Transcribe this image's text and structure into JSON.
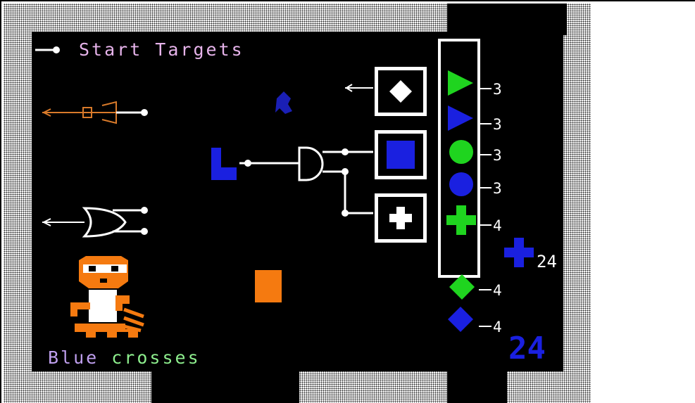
{
  "header": {
    "title": "Start Targets"
  },
  "status": {
    "message": "Blue crosses"
  },
  "targets": [
    {
      "shape": "triangle",
      "color": "#1fd41f",
      "count": "3"
    },
    {
      "shape": "triangle",
      "color": "#1a20e0",
      "count": "3"
    },
    {
      "shape": "circle",
      "color": "#1fd41f",
      "count": "3"
    },
    {
      "shape": "circle",
      "color": "#1a20e0",
      "count": "3"
    },
    {
      "shape": "cross",
      "color": "#1fd41f",
      "count": "4"
    }
  ],
  "extra_targets": [
    {
      "shape": "diamond",
      "color": "#1fd41f",
      "count": "4"
    },
    {
      "shape": "diamond",
      "color": "#1a20e0",
      "count": "4"
    }
  ],
  "score": {
    "item_count": "24",
    "corner_number": "24"
  },
  "gate_boxes": [
    {
      "symbol": "diamond",
      "color": "#ffffff"
    },
    {
      "symbol": "square",
      "color": "#1a20e0"
    },
    {
      "symbol": "cross",
      "color": "#ffffff"
    }
  ],
  "colors": {
    "green": "#1fd41f",
    "blue": "#1a20e0",
    "orange": "#f57a10",
    "title_text": "#e6b3ea",
    "status_blue": "#c0a0f0",
    "status_green": "#8ef08e"
  }
}
